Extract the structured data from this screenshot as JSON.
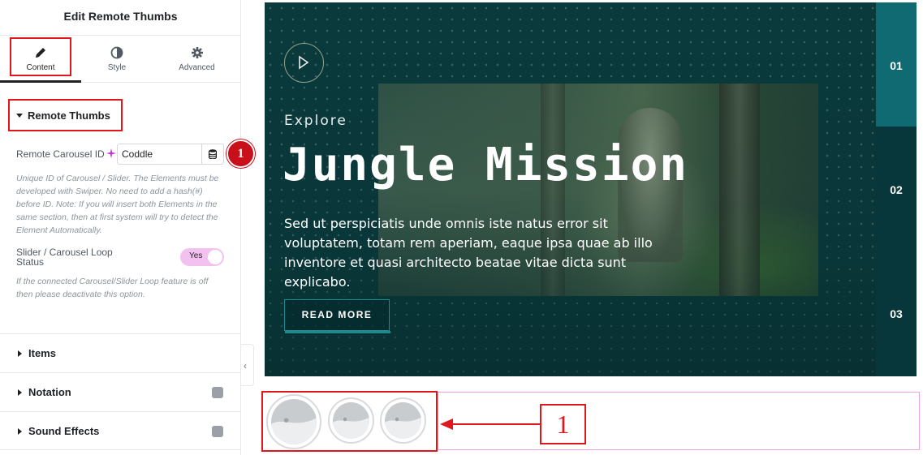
{
  "panel": {
    "title": "Edit Remote Thumbs",
    "tabs": [
      {
        "label": "Content",
        "icon": "pencil-icon"
      },
      {
        "label": "Style",
        "icon": "contrast-icon"
      },
      {
        "label": "Advanced",
        "icon": "gear-icon"
      }
    ],
    "section_title": "Remote Thumbs",
    "carousel_id_label": "Remote Carousel ID",
    "carousel_id_value": "Coddle",
    "carousel_id_help": "Unique ID of Carousel / Slider. The Elements must be developed with Swiper. No need to add a hash(#) before ID. Note: If you will insert both Elements in the same section, then at first system will try to detect the Element Automatically.",
    "loop_label": "Slider / Carousel Loop Status",
    "loop_value": "Yes",
    "loop_help": "If the connected Carousel/Slider Loop feature is off then please deactivate this option.",
    "accordions": [
      "Items",
      "Notation",
      "Sound Effects"
    ],
    "marker_number": "1"
  },
  "hero": {
    "eyebrow": "Explore",
    "headline": "Jungle Mission",
    "description": "Sed ut perspiciatis unde omnis iste natus error sit voluptatem, totam rem aperiam, eaque ipsa quae ab illo inventore et quasi architecto beatae vitae dicta sunt explicabo.",
    "button_label": "READ MORE",
    "slide_numbers": [
      "01",
      "02",
      "03"
    ],
    "active_slide": "01"
  },
  "thumbs": {
    "count": 3,
    "callout_number": "1"
  },
  "colors": {
    "hero_bg": "#0a3a3c",
    "active_slide": "#0f6a72",
    "annotation_red": "#e0181e",
    "toggle_on": "#f3c1f0"
  }
}
